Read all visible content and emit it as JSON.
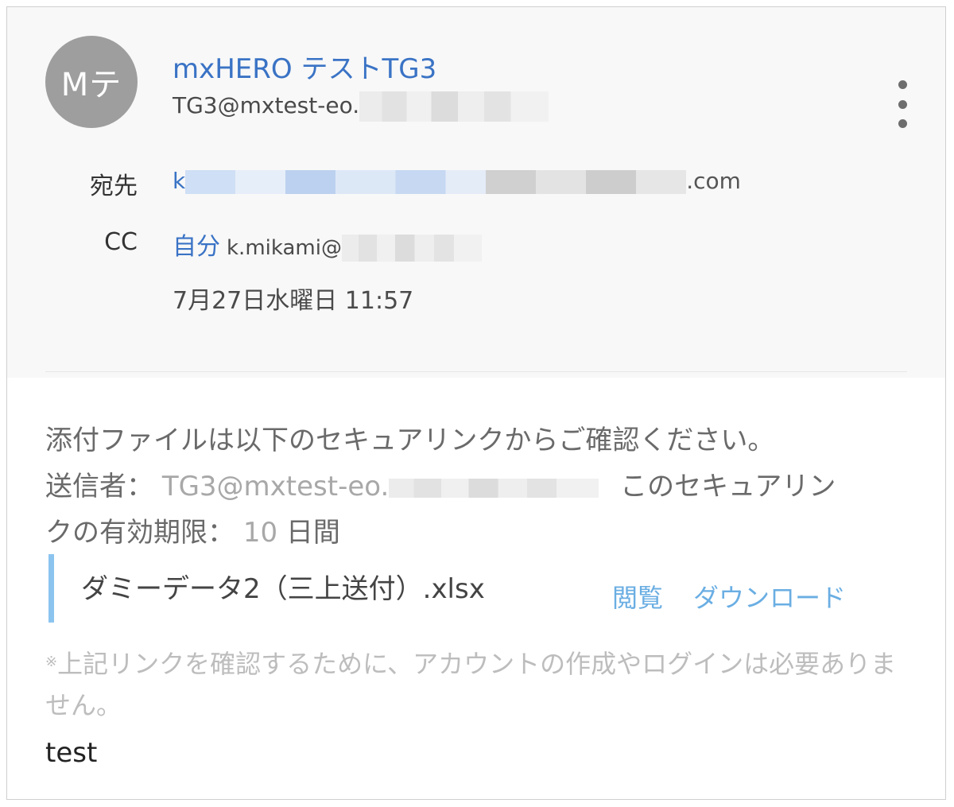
{
  "sender": {
    "avatar_initials": "Mテ",
    "name": "mxHERO テストTG3",
    "email_prefix": "TG3@mxtest-eo."
  },
  "recipients": {
    "to_label": "宛先",
    "to_prefix": "k",
    "to_suffix": ".com",
    "cc_label": "CC",
    "cc_self": "自分",
    "cc_email_prefix": "k.mikami@"
  },
  "date": "7月27日水曜日 11:57",
  "body": {
    "line1": "添付ファイルは以下のセキュアリンクからご確認ください。",
    "sender_label": "送信者：",
    "sender_email": "TG3@mxtest-eo.",
    "expiry_label_a": "このセキュアリン",
    "expiry_label_b": "クの有効期限：",
    "expiry_value": "10",
    "expiry_unit": "日間",
    "attachment_name": "ダミーデータ2（三上送付）.xlsx",
    "view_label": "閲覧",
    "download_label": "ダウンロード",
    "note_mark": "※",
    "note_text": "上記リンクを確認するために、アカウントの作成やログインは必要ありません。",
    "message": "test"
  },
  "colors": {
    "link_blue": "#3a73c5",
    "attachment_bar": "#8cc4f0",
    "avatar_gray": "#9e9e9e"
  },
  "icons": {
    "overflow_menu": "more-vert-icon"
  }
}
